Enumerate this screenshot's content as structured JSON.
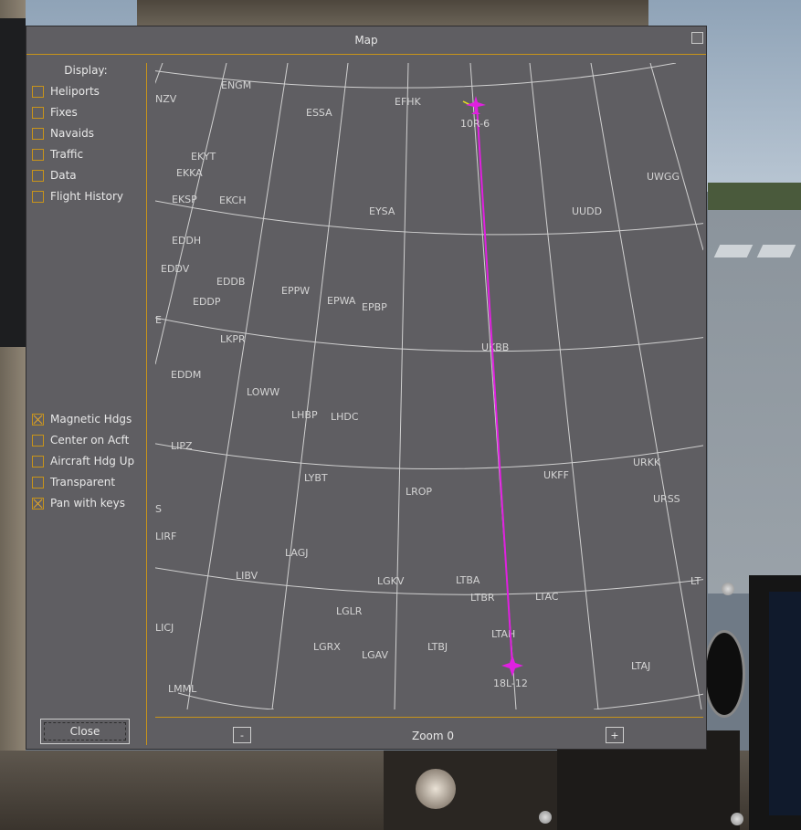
{
  "window": {
    "title": "Map"
  },
  "display": {
    "heading": "Display:",
    "options": [
      {
        "label": "Heliports",
        "checked": false
      },
      {
        "label": "Fixes",
        "checked": false
      },
      {
        "label": "Navaids",
        "checked": false
      },
      {
        "label": "Traffic",
        "checked": false
      },
      {
        "label": "Data",
        "checked": false
      },
      {
        "label": "Flight History",
        "checked": false
      }
    ],
    "settings": [
      {
        "label": "Magnetic Hdgs",
        "checked": true
      },
      {
        "label": "Center on Acft",
        "checked": false
      },
      {
        "label": "Aircraft Hdg Up",
        "checked": false
      },
      {
        "label": "Transparent",
        "checked": false
      },
      {
        "label": "Pan with keys",
        "checked": true
      }
    ]
  },
  "buttons": {
    "close": "Close",
    "zoom_out": "-",
    "zoom_in": "+"
  },
  "zoom": {
    "label": "Zoom 0"
  },
  "colors": {
    "accent": "#c8941a",
    "route": "#e020e0",
    "panel": "#5f5e62"
  },
  "map": {
    "airports": [
      "NZV",
      "ENGM",
      "ESSA",
      "EFHK",
      "EKYT",
      "EKKA",
      "EKSP",
      "EKCH",
      "EYSA",
      "UUDD",
      "UWGG",
      "EDDH",
      "EDDV",
      "EDDB",
      "EPPW",
      "EDDP",
      "EPWA",
      "EPBP",
      "E",
      "LKPR",
      "UKBB",
      "EDDM",
      "LOWW",
      "LHBP",
      "LHDC",
      "LIPZ",
      "LYBT",
      "UKFF",
      "URKK",
      "LROP",
      "URSS",
      "S",
      "LIRF",
      "LAGJ",
      "LIBV",
      "LGKV",
      "LTBA",
      "LT",
      "LTBR",
      "LTAC",
      "LGLR",
      "LICJ",
      "LTAH",
      "LGRX",
      "LGAV",
      "LTBJ",
      "LTAJ",
      "LMML"
    ],
    "route": {
      "origin_label": "10R-6",
      "destination_label": "18L-12"
    }
  }
}
